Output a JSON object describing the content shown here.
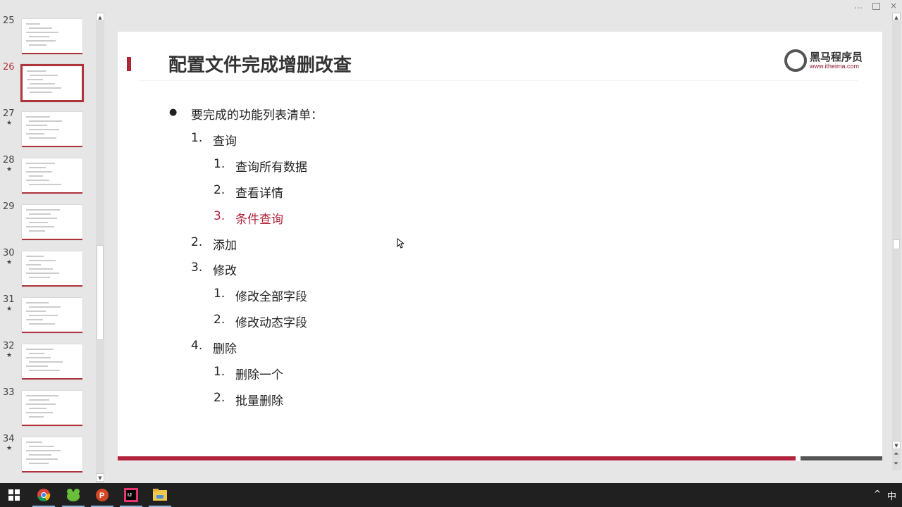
{
  "window": {
    "more_icon": "…",
    "restore_icon": "restore",
    "close_icon": "×"
  },
  "thumbnails": [
    {
      "num": "25",
      "star": false
    },
    {
      "num": "26",
      "star": false,
      "active": true
    },
    {
      "num": "27",
      "star": true
    },
    {
      "num": "28",
      "star": true
    },
    {
      "num": "29",
      "star": false
    },
    {
      "num": "30",
      "star": true
    },
    {
      "num": "31",
      "star": true
    },
    {
      "num": "32",
      "star": true
    },
    {
      "num": "33",
      "star": false
    },
    {
      "num": "34",
      "star": true
    }
  ],
  "star_glyph": "★",
  "slide": {
    "title": "配置文件完成增删改查",
    "logo_cn": "黑马程序员",
    "logo_url": "www.itheima.com",
    "items": [
      {
        "level": 0,
        "num": "●",
        "text": "要完成的功能列表清单："
      },
      {
        "level": 1,
        "num": "1.",
        "text": "查询"
      },
      {
        "level": 2,
        "num": "1.",
        "text": "查询所有数据"
      },
      {
        "level": 2,
        "num": "2.",
        "text": "查看详情"
      },
      {
        "level": 2,
        "num": "3.",
        "text": "条件查询",
        "highlight": true
      },
      {
        "level": 1,
        "num": "2.",
        "text": "添加"
      },
      {
        "level": 1,
        "num": "3.",
        "text": "修改"
      },
      {
        "level": 2,
        "num": "1.",
        "text": "修改全部字段"
      },
      {
        "level": 2,
        "num": "2.",
        "text": "修改动态字段"
      },
      {
        "level": 1,
        "num": "4.",
        "text": "删除"
      },
      {
        "level": 2,
        "num": "1.",
        "text": "删除一个"
      },
      {
        "level": 2,
        "num": "2.",
        "text": "批量删除"
      }
    ]
  },
  "taskbar": {
    "apps": [
      "start",
      "chrome",
      "wechat-like",
      "powerpoint",
      "intellij",
      "file-explorer"
    ],
    "tray_chevron": "^",
    "ime": "中"
  },
  "colors": {
    "accent": "#b0243c",
    "taskbar": "#202020"
  }
}
